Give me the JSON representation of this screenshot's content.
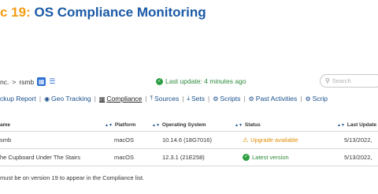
{
  "slide": {
    "title_prefix": "c 19:",
    "title_main": " OS Compliance Monitoring"
  },
  "breadcrumb": {
    "parent": "nc.",
    "separator": ">",
    "current": "rsmb"
  },
  "last_update": "Last update: 4 minutes ago",
  "search": {
    "placeholder": "Search"
  },
  "nav": {
    "items": [
      {
        "label": "ckup Report",
        "icon": ""
      },
      {
        "label": "Geo Tracking",
        "icon": "globe-icon"
      },
      {
        "label": "Compliance",
        "icon": "table-icon",
        "active": true
      },
      {
        "label": "Sources",
        "icon": "upload-icon"
      },
      {
        "label": "Sets",
        "icon": "download-icon"
      },
      {
        "label": "Scripts",
        "icon": "gear-icon"
      },
      {
        "label": "Past Activities",
        "icon": "gears-icon"
      },
      {
        "label": "Scrip",
        "icon": "gears-icon"
      }
    ]
  },
  "table": {
    "columns": [
      "ame",
      "Platform",
      "Operating System",
      "Status",
      "Last Update"
    ],
    "rows": [
      {
        "name": "smb",
        "platform": "macOS",
        "os": "10.14.6 (18G7016)",
        "status": "Upgrade available",
        "status_type": "warning",
        "last_update": "5/13/2022,"
      },
      {
        "name": "he Cupboard Under The Stairs",
        "platform": "macOS",
        "os": "12.3.1 (21E258)",
        "status": "Latest version",
        "status_type": "ok",
        "last_update": "5/13/2022,"
      }
    ]
  },
  "footer_note": "must be on version 19 to appear in the Compliance list.",
  "colors": {
    "title_blue": "#1a5aa6",
    "title_orange": "#f39c12",
    "ok_green": "#2d8a3a",
    "warn_orange": "#e08a00",
    "link_blue": "#1a4f8a"
  }
}
